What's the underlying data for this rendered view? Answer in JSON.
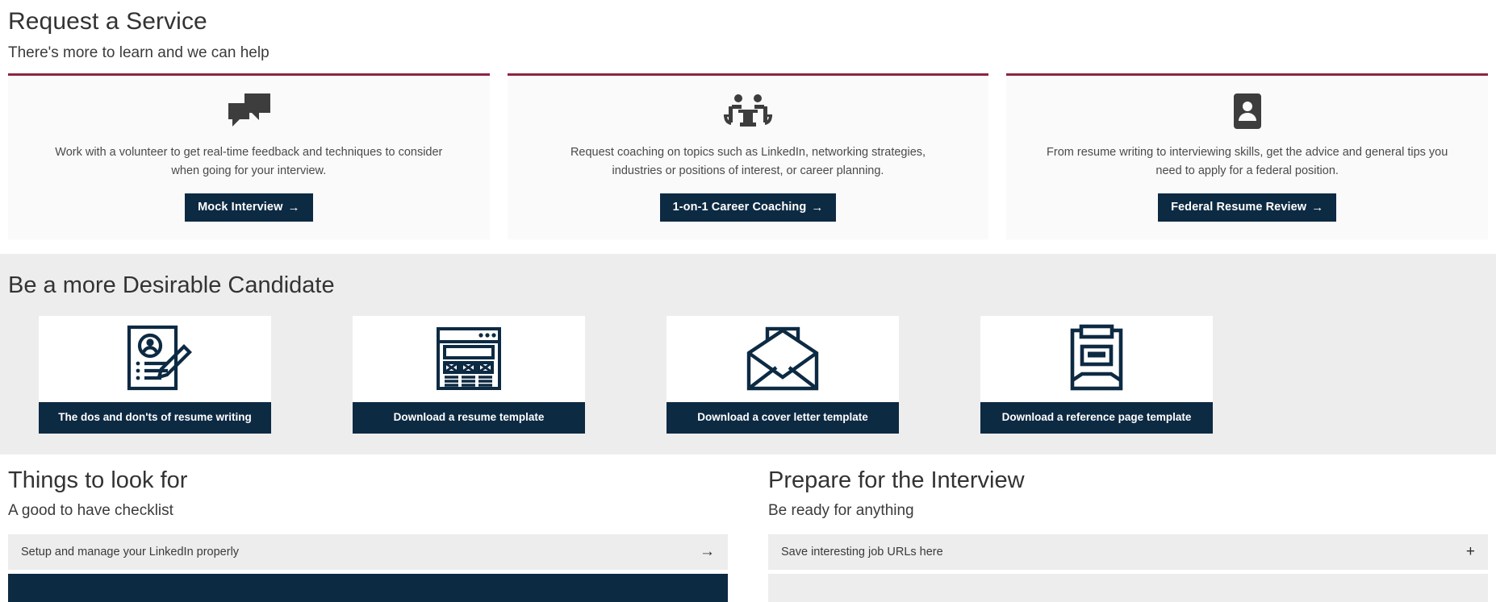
{
  "service_section": {
    "title": "Request a Service",
    "subtitle": "There's more to learn and we can help",
    "accent_color": "#8d2340",
    "button_color": "#0d2a43",
    "cards": [
      {
        "icon": "speech-bubbles-icon",
        "description": "Work with a volunteer to get real-time feedback and techniques to consider when going for your interview.",
        "button_label": "Mock Interview",
        "button_arrow": "→"
      },
      {
        "icon": "two-people-at-table-icon",
        "description": "Request coaching on topics such as LinkedIn, networking strategies, industries or positions of interest, or career planning.",
        "button_label": "1-on-1 Career Coaching",
        "button_arrow": "→"
      },
      {
        "icon": "person-badge-icon",
        "description": "From resume writing to interviewing skills, get the advice and general tips you need to apply for a federal position.",
        "button_label": "Federal Resume Review",
        "button_arrow": "→"
      }
    ]
  },
  "candidate_section": {
    "title": "Be a more Desirable Candidate",
    "background_color": "#ededed",
    "tiles": [
      {
        "icon": "resume-document-pencil-icon",
        "label": "The dos and don'ts of resume writing"
      },
      {
        "icon": "resume-template-wireframe-icon",
        "label": "Download a resume template"
      },
      {
        "icon": "open-envelope-letter-icon",
        "label": "Download a cover letter template"
      },
      {
        "icon": "reference-clipboard-icon",
        "label": "Download a reference page template"
      }
    ]
  },
  "columns": [
    {
      "title": "Things to look for",
      "subtitle": "A good to have checklist",
      "rows": [
        {
          "text": "Setup and manage your LinkedIn properly",
          "icon": "arrow-right-icon",
          "style": "light"
        },
        {
          "text": "",
          "icon": "",
          "style": "dark"
        }
      ]
    },
    {
      "title": "Prepare for the Interview",
      "subtitle": "Be ready for anything",
      "rows": [
        {
          "text": "Save interesting job URLs here",
          "icon": "plus-icon",
          "style": "light"
        },
        {
          "text": "",
          "icon": "",
          "style": "light"
        }
      ]
    }
  ]
}
